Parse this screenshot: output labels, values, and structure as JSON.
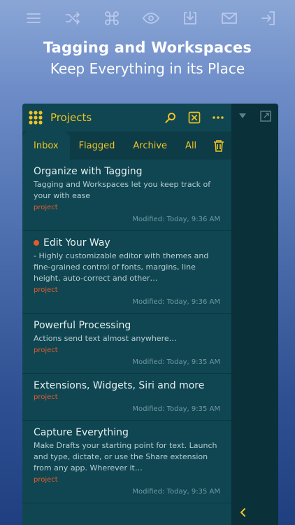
{
  "toolbar": {
    "icons": [
      "menu-icon",
      "shuffle-icon",
      "command-icon",
      "eye-icon",
      "download-icon",
      "mail-icon",
      "sign-in-icon"
    ]
  },
  "headline": {
    "title": "Tagging and Workspaces",
    "subtitle": "Keep Everything in its Place"
  },
  "app": {
    "title": "Projects",
    "accent": "#f0c323",
    "tag_color": "#e35c2e"
  },
  "tabs": [
    "Inbox",
    "Flagged",
    "Archive",
    "All"
  ],
  "items": [
    {
      "title": "Organize with Tagging",
      "desc": "Tagging and Workspaces let you keep track of your with ease",
      "tag": "project",
      "modified": "Modified: Today, 9:36 AM",
      "dot": false
    },
    {
      "title": "Edit Your Way",
      "desc": "- Highly customizable editor with themes and fine-grained control of fonts, margins, line height, auto-correct and other…",
      "tag": "project",
      "modified": "Modified: Today, 9:36 AM",
      "dot": true
    },
    {
      "title": "Powerful Processing",
      "desc": "Actions send text almost anywhere…",
      "tag": "project",
      "modified": "Modified: Today, 9:35 AM",
      "dot": false
    },
    {
      "title": "Extensions, Widgets, Siri and more",
      "desc": "",
      "tag": "project",
      "modified": "Modified: Today, 9:35 AM",
      "dot": false
    },
    {
      "title": "Capture Everything",
      "desc": "Make Drafts your starting point for text. Launch and type, dictate, or use the Share extension from any app. Wherever it…",
      "tag": "project",
      "modified": "Modified: Today, 9:35 AM",
      "dot": false
    }
  ]
}
